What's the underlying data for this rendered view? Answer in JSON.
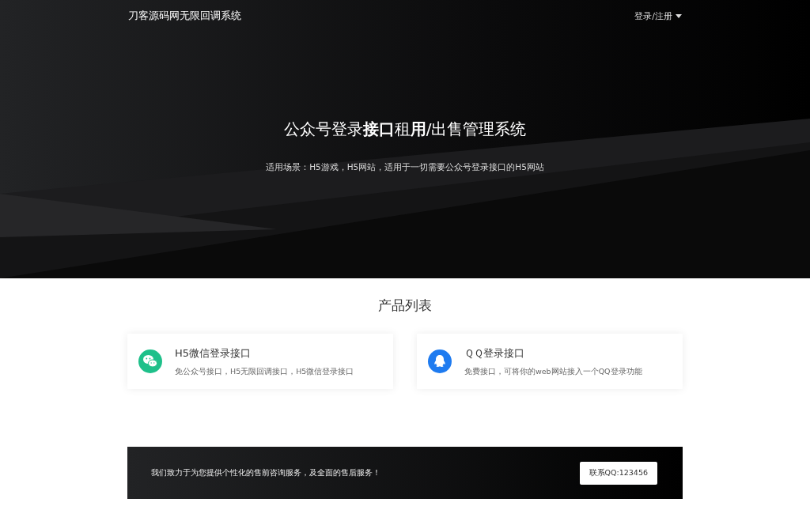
{
  "navbar": {
    "brand": "刀客源码网无限回调系统",
    "user_menu": "登录/注册"
  },
  "hero": {
    "title": "公众号登录**接口**租**用**/出售管理系统",
    "subtitle": "适用场景：H5游戏，H5网站，适用于一切需要公众号登录接口的H5网站"
  },
  "products": {
    "heading": "产品列表",
    "items": [
      {
        "kind": "wechat",
        "title": "H5微信登录接口",
        "description": "免公众号接口，H5无限回调接口，H5微信登录接口"
      },
      {
        "kind": "qq",
        "title": "ＱＱ登录接口",
        "description": "免费接口，可将你的web网站接入一个QQ登录功能"
      }
    ]
  },
  "contact_banner": {
    "text": "我们致力于为您提供个性化的售前咨询服务，及全面的售后服务！",
    "button": "联系QQ:123456"
  }
}
